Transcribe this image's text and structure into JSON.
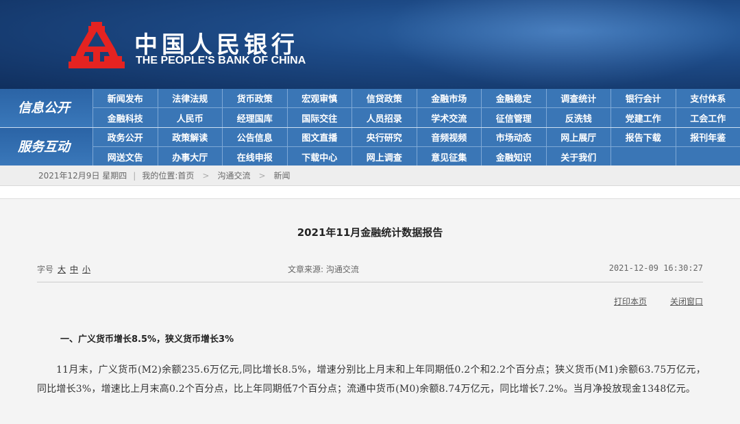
{
  "header": {
    "name_cn": "中国人民银行",
    "name_en": "THE PEOPLE'S BANK OF CHINA",
    "logo_icon": "pboc-logo-icon",
    "logo_color": "#e52321"
  },
  "nav": {
    "info_title": "信息公开",
    "info_row1": [
      "新闻发布",
      "法律法规",
      "货币政策",
      "宏观审慎",
      "信贷政策",
      "金融市场",
      "金融稳定",
      "调查统计",
      "银行会计",
      "支付体系"
    ],
    "info_row2": [
      "金融科技",
      "人民币",
      "经理国库",
      "国际交往",
      "人员招录",
      "学术交流",
      "征信管理",
      "反洗钱",
      "党建工作",
      "工会工作"
    ],
    "service_title": "服务互动",
    "service_row1": [
      "政务公开",
      "政策解读",
      "公告信息",
      "图文直播",
      "央行研究",
      "音频视频",
      "市场动态",
      "网上展厅",
      "报告下载",
      "报刊年鉴"
    ],
    "service_row2": [
      "网送文告",
      "办事大厅",
      "在线申报",
      "下载中心",
      "网上调查",
      "意见征集",
      "金融知识",
      "关于我们"
    ]
  },
  "breadcrumb": {
    "date": "2021年12月9日 星期四",
    "location_label": "我的位置:",
    "items": [
      "首页",
      "沟通交流",
      "新闻"
    ]
  },
  "article": {
    "title": "2021年11月金融统计数据报告",
    "font_label": "字号",
    "font_large": "大",
    "font_medium": "中",
    "font_small": "小",
    "source": "文章来源: 沟通交流",
    "time": "2021-12-09 16:30:27",
    "print_label": "打印本页",
    "close_label": "关闭窗口",
    "section_heading": "一、广义货币增长8.5%，狭义货币增长3%",
    "paragraph": "11月末，广义货币(M2)余额235.6万亿元,同比增长8.5%，增速分别比上月末和上年同期低0.2个和2.2个百分点；狭义货币(M1)余额63.75万亿元，同比增长3%，增速比上月末高0.2个百分点，比上年同期低7个百分点；流通中货币(M0)余额8.74万亿元，同比增长7.2%。当月净投放现金1348亿元。"
  }
}
